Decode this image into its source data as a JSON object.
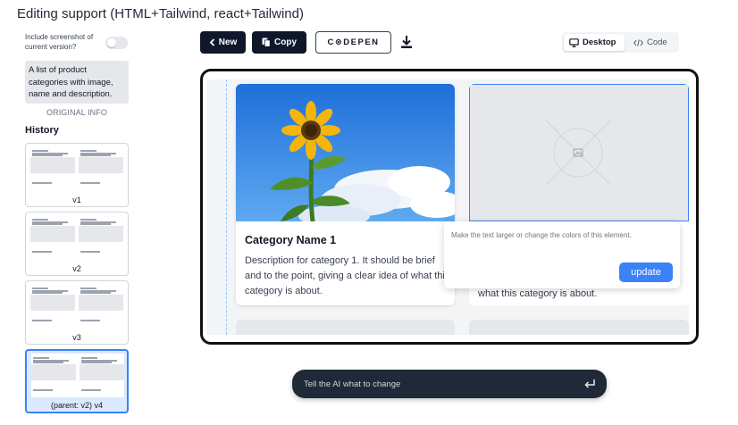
{
  "page": {
    "title": "Editing support (HTML+Tailwind, react+Tailwind)"
  },
  "sidebar": {
    "toggle_label": "Include screenshot of current version?",
    "toggle_on": false,
    "prompt": "A list of product categories with image, name and description.",
    "original_info": "ORIGINAL INFO",
    "history_title": "History",
    "history": [
      {
        "label": "v1",
        "active": false
      },
      {
        "label": "v2",
        "active": false
      },
      {
        "label": "v3",
        "active": false
      },
      {
        "label": "(parent: v2) v4",
        "active": true
      }
    ]
  },
  "toolbar": {
    "new_label": "New",
    "copy_label": "Copy",
    "codepen_label": "C⊗DEPEN",
    "download_icon": "download-icon",
    "view": {
      "desktop_label": "Desktop",
      "code_label": "Code",
      "selected": "Desktop"
    }
  },
  "preview": {
    "card1": {
      "title": "Category Name 1",
      "description": "Description for category 1. It should be brief and to the point, giving a clear idea of what this category is about."
    },
    "card2": {
      "bottom_text": "what this category is about."
    },
    "edit_popover": {
      "placeholder": "Make the text larger or change the colors of this element.",
      "update_label": "update"
    }
  },
  "ai_bar": {
    "placeholder": "Tell the AI what to change",
    "enter_icon": "enter-icon"
  },
  "colors": {
    "primary_dark": "#0f172a",
    "accent_blue": "#3b82f6",
    "ai_bar": "#1f2937"
  }
}
